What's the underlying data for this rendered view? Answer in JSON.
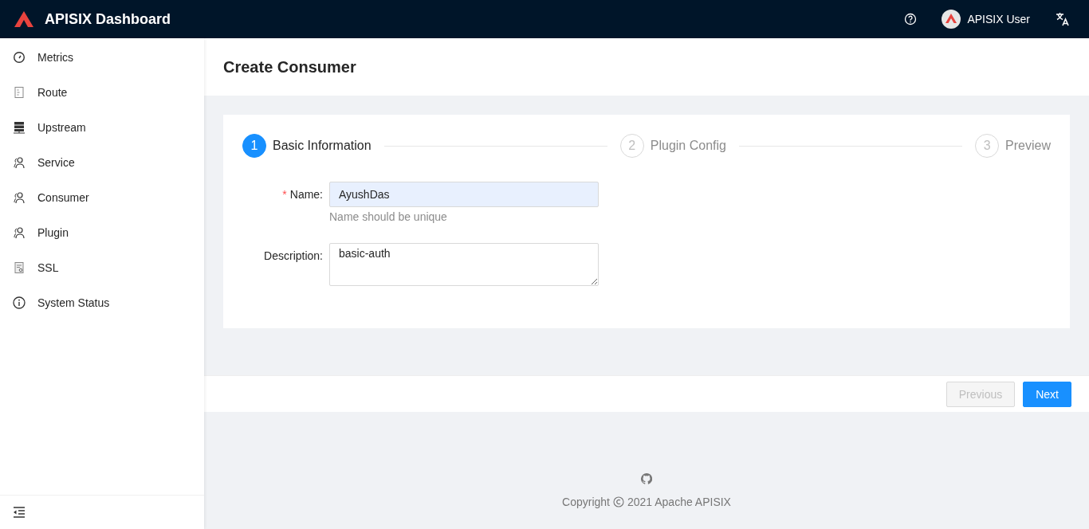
{
  "header": {
    "title": "APISIX Dashboard",
    "user": "APISIX User"
  },
  "sidebar": {
    "items": [
      {
        "label": "Metrics",
        "selected": false
      },
      {
        "label": "Route",
        "selected": false
      },
      {
        "label": "Upstream",
        "selected": false
      },
      {
        "label": "Service",
        "selected": false
      },
      {
        "label": "Consumer",
        "selected": false
      },
      {
        "label": "Plugin",
        "selected": false
      },
      {
        "label": "SSL",
        "selected": false
      },
      {
        "label": "System Status",
        "selected": false
      }
    ]
  },
  "page_title": "Create Consumer",
  "steps": [
    {
      "number": "1",
      "label": "Basic Information",
      "selected": true
    },
    {
      "number": "2",
      "label": "Plugin Config",
      "selected": false
    },
    {
      "number": "3",
      "label": "Preview",
      "selected": false
    }
  ],
  "form": [
    {
      "kind": "input",
      "required_mark": "*",
      "label": "Name:",
      "value": "AyushDas",
      "help": "Name should be unique"
    },
    {
      "kind": "textarea",
      "label": "Description:",
      "value": "basic-auth"
    }
  ],
  "buttons": [
    {
      "label": "Previous",
      "kind": "default",
      "disabled": true
    },
    {
      "label": "Next",
      "kind": "primary",
      "disabled": false
    }
  ],
  "footer": {
    "copyright_prefix": "Copyright",
    "copyright_text": "2021 Apache APISIX"
  }
}
